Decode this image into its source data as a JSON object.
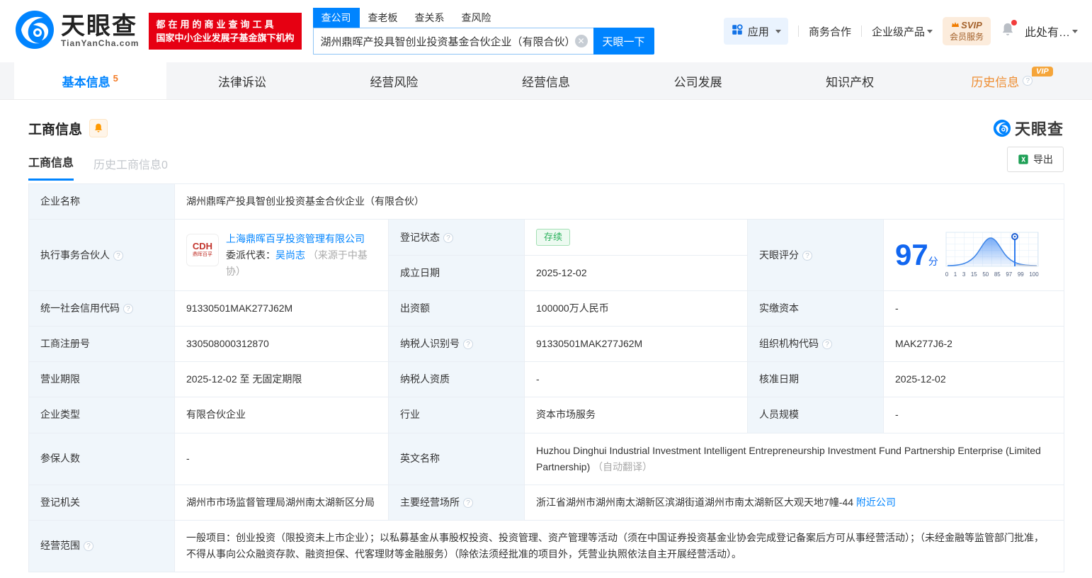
{
  "brand": {
    "name": "天眼查",
    "domain": "TianYanCha.com",
    "slogan_line1": "都在用的商业查询工具",
    "slogan_line2": "国家中小企业发展子基金旗下机构",
    "primary_color": "#0084ff",
    "banner_color": "#e60012"
  },
  "search": {
    "tabs": [
      {
        "label": "查公司"
      },
      {
        "label": "查老板"
      },
      {
        "label": "查关系"
      },
      {
        "label": "查风险"
      }
    ],
    "value": "湖州鼎晖产投具智创业投资基金合伙企业（有限合伙）",
    "button_label": "天眼一下"
  },
  "topnav": {
    "apps_label": "应用",
    "cooperation_label": "商务合作",
    "enterprise_label": "企业级产品",
    "svip_line1": "SVIP",
    "svip_line2": "会员服务",
    "user_label": "此处有…"
  },
  "tabs": [
    {
      "label": "基本信息",
      "count": "5"
    },
    {
      "label": "法律诉讼"
    },
    {
      "label": "经营风险"
    },
    {
      "label": "经营信息"
    },
    {
      "label": "公司发展"
    },
    {
      "label": "知识产权"
    },
    {
      "label": "历史信息",
      "badge": "VIP"
    }
  ],
  "section": {
    "title": "工商信息",
    "subtab_active": "工商信息",
    "subtab_history": "历史工商信息0",
    "export_label": "导出",
    "watermark": "天眼查"
  },
  "score": {
    "label": "天眼评分",
    "value": "97",
    "unit": "分",
    "chart": {
      "type": "area",
      "ticks": [
        "0",
        "1",
        "3",
        "15",
        "50",
        "85",
        "97",
        "99",
        "100"
      ],
      "marker": "97"
    }
  },
  "fields": {
    "company_name": {
      "label": "企业名称",
      "value": "湖州鼎晖产投具智创业投资基金合伙企业（有限合伙）"
    },
    "partner": {
      "label": "执行事务合伙人",
      "company": "上海鼎晖百孚投资管理有限公司",
      "logo_text": "CDH",
      "logo_sub": "鼎晖百孚",
      "rep_label": "委派代表：",
      "rep_name": "吴尚志",
      "rep_source": "（来源于中基协）"
    },
    "reg_status": {
      "label": "登记状态",
      "value": "存续"
    },
    "establish_date": {
      "label": "成立日期",
      "value": "2025-12-02"
    },
    "credit_code": {
      "label": "统一社会信用代码",
      "value": "91330501MAK277J62M"
    },
    "contribution": {
      "label": "出资额",
      "value": "100000万人民币"
    },
    "paid_capital": {
      "label": "实缴资本",
      "value": "-"
    },
    "reg_number": {
      "label": "工商注册号",
      "value": "330508000312870"
    },
    "taxpayer_id": {
      "label": "纳税人识别号",
      "value": "91330501MAK277J62M"
    },
    "org_code": {
      "label": "组织机构代码",
      "value": "MAK277J6-2"
    },
    "business_term": {
      "label": "营业期限",
      "value": "2025-12-02 至 无固定期限"
    },
    "taxpayer_quality": {
      "label": "纳税人资质",
      "value": "-"
    },
    "approval_date": {
      "label": "核准日期",
      "value": "2025-12-02"
    },
    "company_type": {
      "label": "企业类型",
      "value": "有限合伙企业"
    },
    "industry": {
      "label": "行业",
      "value": "资本市场服务"
    },
    "staff_size": {
      "label": "人员规模",
      "value": "-"
    },
    "insured_count": {
      "label": "参保人数",
      "value": "-"
    },
    "english_name": {
      "label": "英文名称",
      "value": "Huzhou Dinghui Industrial Investment Intelligent Entrepreneurship Investment Fund Partnership Enterprise (Limited Partnership)",
      "note": "（自动翻译）"
    },
    "reg_authority": {
      "label": "登记机关",
      "value": "湖州市市场监督管理局湖州南太湖新区分局"
    },
    "business_address": {
      "label": "主要经营场所",
      "value": "浙江省湖州市湖州南太湖新区滨湖街道湖州市南太湖新区大观天地7幢-44",
      "link": "附近公司"
    },
    "business_scope": {
      "label": "经营范围",
      "value": "一般项目：创业投资（限投资未上市企业）；以私募基金从事股权投资、投资管理、资产管理等活动（须在中国证券投资基金业协会完成登记备案后方可从事经营活动）；（未经金融等监管部门批准，不得从事向公众融资存款、融资担保、代客理财等金融服务）（除依法须经批准的项目外，凭营业执照依法自主开展经营活动）。"
    }
  }
}
